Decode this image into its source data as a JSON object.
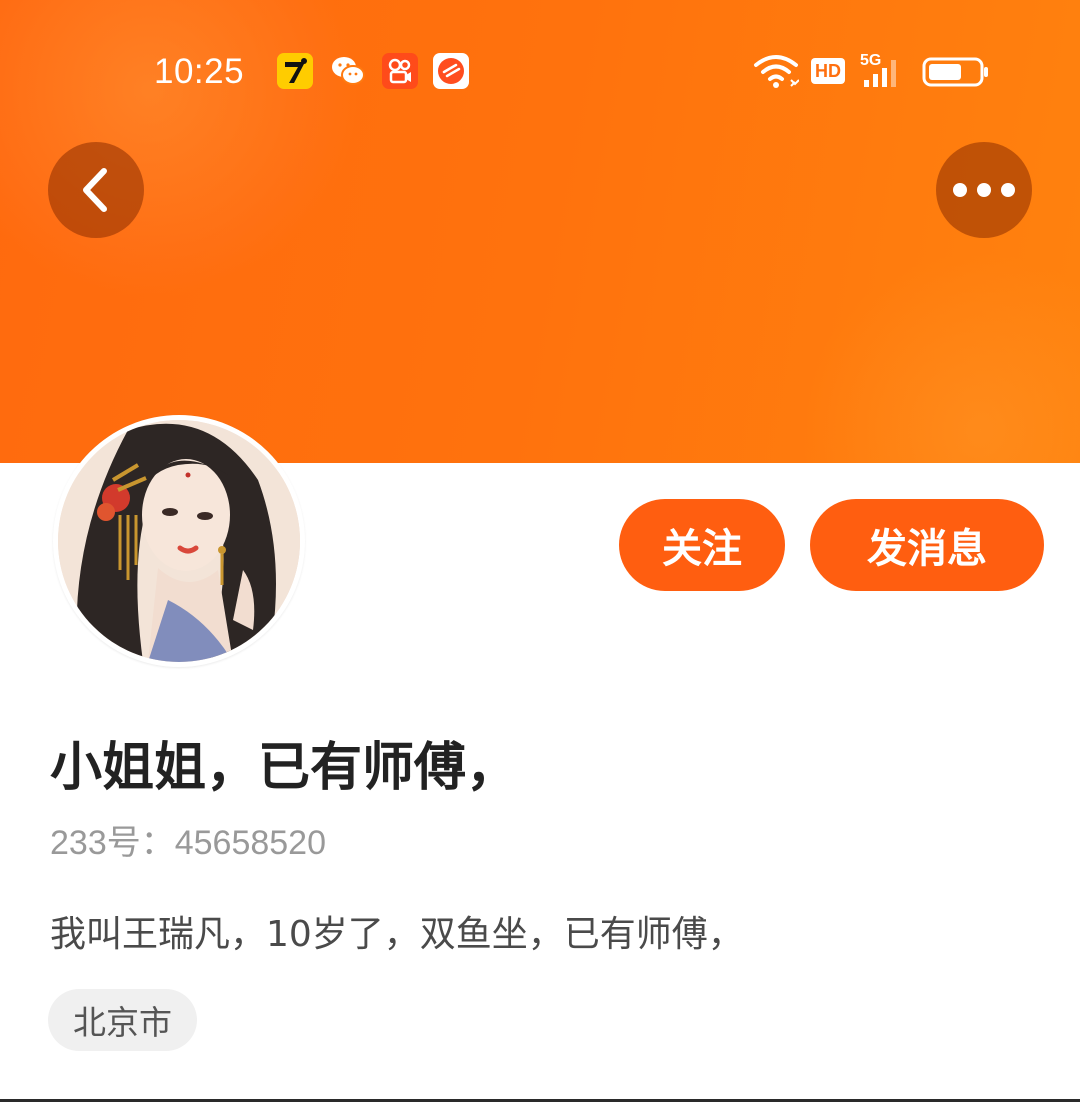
{
  "status_bar": {
    "time": "10:25",
    "notification_icons": [
      "qimao-app-icon",
      "wechat-icon",
      "kuaishou-icon",
      "browser-app-icon"
    ],
    "right_icons": [
      "wifi-icon",
      "hd-icon",
      "5g-signal-icon",
      "battery-icon"
    ],
    "hd_label": "HD",
    "network_label": "5G"
  },
  "header": {
    "back_icon": "chevron-left-icon",
    "more_icon": "more-dots-icon",
    "accent_color": "#ff6a0e"
  },
  "profile": {
    "name": "小姐姐，已有师傅，",
    "id_line": "233号：45658520",
    "bio": "我叫王瑞凡，10岁了，双鱼坐，已有师傅，",
    "location_tag": "北京市"
  },
  "actions": {
    "follow_label": "关注",
    "message_label": "发消息",
    "button_color": "#ff5e10"
  }
}
